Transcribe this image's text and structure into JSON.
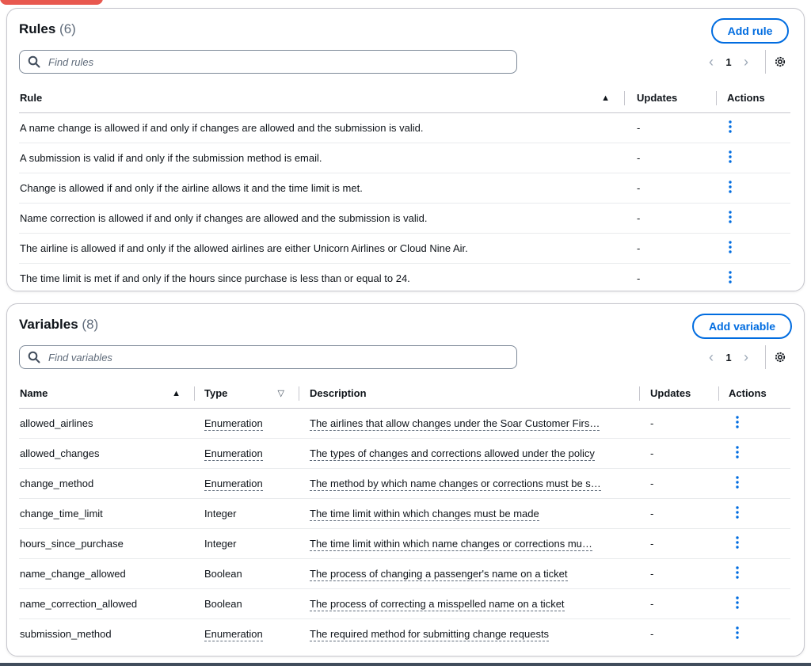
{
  "rules_panel": {
    "title": "Rules",
    "count": "(6)",
    "add_label": "Add rule",
    "search_placeholder": "Find rules",
    "page": "1",
    "columns": [
      "Rule",
      "Updates",
      "Actions"
    ],
    "rows": [
      {
        "rule": "A name change is allowed if and only if changes are allowed and the submission is valid.",
        "updates": "-"
      },
      {
        "rule": "A submission is valid if and only if the submission method is email.",
        "updates": "-"
      },
      {
        "rule": "Change is allowed if and only if the airline allows it and the time limit is met.",
        "updates": "-"
      },
      {
        "rule": "Name correction is allowed if and only if changes are allowed and the submission is valid.",
        "updates": "-"
      },
      {
        "rule": "The airline is allowed if and only if the allowed airlines are either Unicorn Airlines or Cloud Nine Air.",
        "updates": "-"
      },
      {
        "rule": "The time limit is met if and only if the hours since purchase is less than or equal to 24.",
        "updates": "-"
      }
    ]
  },
  "variables_panel": {
    "title": "Variables",
    "count": "(8)",
    "add_label": "Add variable",
    "search_placeholder": "Find variables",
    "page": "1",
    "columns": [
      "Name",
      "Type",
      "Description",
      "Updates",
      "Actions"
    ],
    "rows": [
      {
        "name": "allowed_airlines",
        "type": "Enumeration",
        "description": "The airlines that allow changes under the Soar Customer Firs…",
        "updates": "-"
      },
      {
        "name": "allowed_changes",
        "type": "Enumeration",
        "description": "The types of changes and corrections allowed under the policy",
        "updates": "-"
      },
      {
        "name": "change_method",
        "type": "Enumeration",
        "description": "The method by which name changes or corrections must be s…",
        "updates": "-"
      },
      {
        "name": "change_time_limit",
        "type": "Integer",
        "description": "The time limit within which changes must be made",
        "updates": "-"
      },
      {
        "name": "hours_since_purchase",
        "type": "Integer",
        "description": "The time limit within which name changes or corrections mu…",
        "updates": "-"
      },
      {
        "name": "name_change_allowed",
        "type": "Boolean",
        "description": "The process of changing a passenger's name on a ticket",
        "updates": "-"
      },
      {
        "name": "name_correction_allowed",
        "type": "Boolean",
        "description": "The process of correcting a misspelled name on a ticket",
        "updates": "-"
      },
      {
        "name": "submission_method",
        "type": "Enumeration",
        "description": "The required method for submitting change requests",
        "updates": "-"
      }
    ]
  },
  "icons": {
    "search": "search-icon",
    "gear": "gear-icon",
    "prev": "chevron-left-icon",
    "next": "chevron-right-icon",
    "actions": "kebab-menu-icon",
    "sort_asc": "sort-ascending-icon",
    "sort_none": "sort-unsorted-icon"
  },
  "colors": {
    "accent": "#006ce0",
    "border": "#c6c6cd",
    "muted": "#5f6b7a"
  }
}
